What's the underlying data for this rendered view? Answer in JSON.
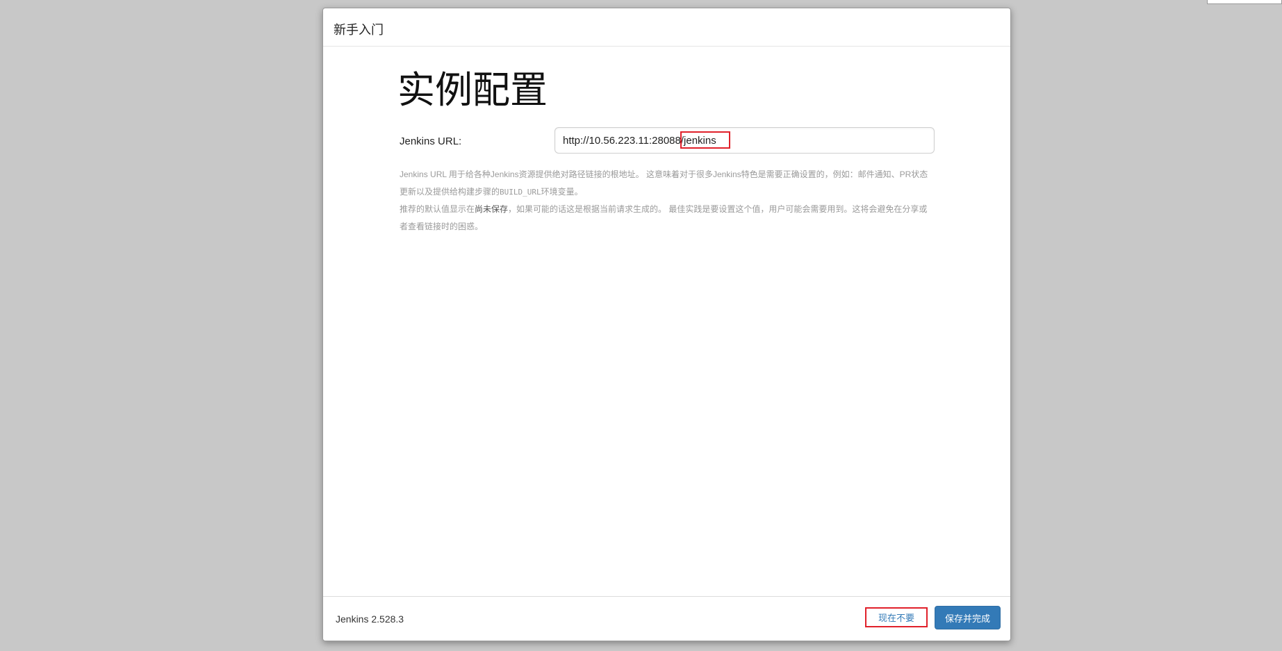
{
  "dialog": {
    "title": "新手入门"
  },
  "page": {
    "heading": "实例配置"
  },
  "url_field": {
    "label": "Jenkins URL:",
    "value": "http://10.56.223.11:28088/jenkins"
  },
  "help": {
    "p1_a": "Jenkins URL 用于给各种Jenkins资源提供绝对路径链接的根地址。 这意味着对于很多Jenkins特色是需要正确设置的，例如：邮件通知、PR状态更新以及提供给构建步骤的",
    "p1_code": "BUILD_URL",
    "p1_b": "环境变量。",
    "p2_a": "推荐的默认值显示在",
    "p2_em": "尚未保存",
    "p2_b": "，如果可能的话这是根据当前请求生成的。 最佳实践是要设置这个值，用户可能会需要用到。这将会避免在分享或者查看链接时的困惑。"
  },
  "footer": {
    "version": "Jenkins 2.528.3",
    "skip_label": "现在不要",
    "save_label": "保存并完成"
  },
  "colors": {
    "primary": "#337ab7",
    "highlight": "#e0202a",
    "backdrop": "#c8c8c8"
  }
}
